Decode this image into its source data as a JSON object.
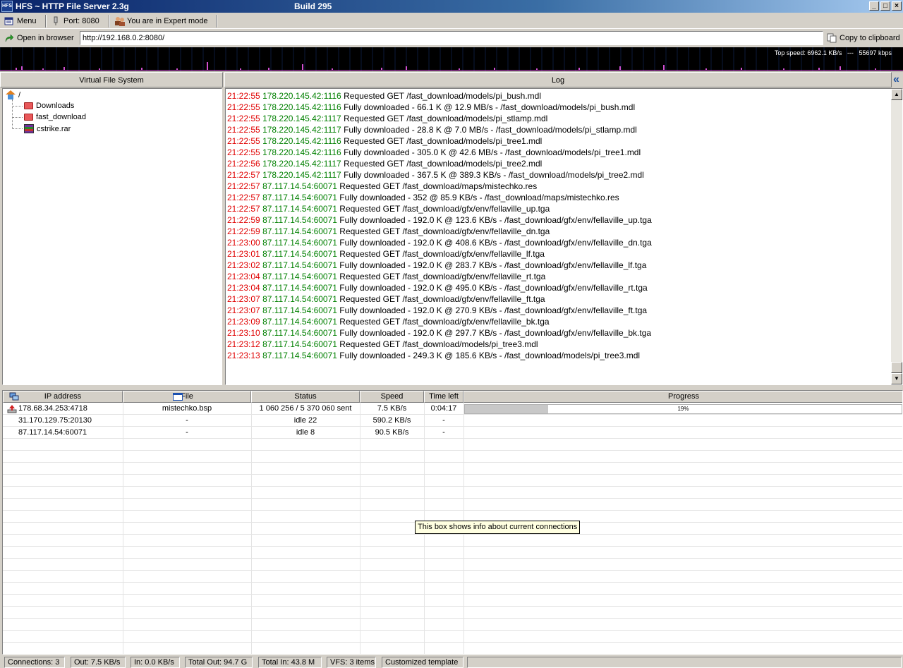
{
  "window": {
    "title": "HFS ~ HTTP File Server 2.3g",
    "build": "Build 295",
    "icon_label": "HFS",
    "buttons": [
      "_",
      "□",
      "×"
    ]
  },
  "toolbar": {
    "menu_label": "Menu",
    "port_label": "Port: 8080",
    "mode_label": "You are in Expert mode",
    "open_browser_label": "Open in browser",
    "url": "http://192.168.0.2:8080/",
    "copy_label": "Copy to clipboard"
  },
  "graph": {
    "top_speed": "Top speed: 6962.1 KB/s",
    "separator": "---",
    "current": "55697 kbps"
  },
  "vfs": {
    "header": "Virtual File System",
    "root": "/",
    "items": [
      {
        "label": "Downloads",
        "icon": "folder-icon"
      },
      {
        "label": "fast_download",
        "icon": "folder-icon"
      },
      {
        "label": "cstrike.rar",
        "icon": "rar-archive-icon"
      }
    ]
  },
  "log": {
    "header": "Log",
    "collapse_glyph": "«",
    "lines": [
      {
        "time": "21:22:55",
        "ip": "178.220.145.42:1116",
        "msg": "Requested GET /fast_download/models/pi_bush.mdl"
      },
      {
        "time": "21:22:55",
        "ip": "178.220.145.42:1116",
        "msg": "Fully downloaded - 66.1 K @ 12.9 MB/s - /fast_download/models/pi_bush.mdl"
      },
      {
        "time": "21:22:55",
        "ip": "178.220.145.42:1117",
        "msg": "Requested GET /fast_download/models/pi_stlamp.mdl"
      },
      {
        "time": "21:22:55",
        "ip": "178.220.145.42:1117",
        "msg": "Fully downloaded - 28.8 K @ 7.0 MB/s - /fast_download/models/pi_stlamp.mdl"
      },
      {
        "time": "21:22:55",
        "ip": "178.220.145.42:1116",
        "msg": "Requested GET /fast_download/models/pi_tree1.mdl"
      },
      {
        "time": "21:22:55",
        "ip": "178.220.145.42:1116",
        "msg": "Fully downloaded - 305.0 K @ 42.6 MB/s - /fast_download/models/pi_tree1.mdl"
      },
      {
        "time": "21:22:56",
        "ip": "178.220.145.42:1117",
        "msg": "Requested GET /fast_download/models/pi_tree2.mdl"
      },
      {
        "time": "21:22:57",
        "ip": "178.220.145.42:1117",
        "msg": "Fully downloaded - 367.5 K @ 389.3 KB/s - /fast_download/models/pi_tree2.mdl"
      },
      {
        "time": "21:22:57",
        "ip": "87.117.14.54:60071",
        "msg": "Requested GET /fast_download/maps/mistechko.res"
      },
      {
        "time": "21:22:57",
        "ip": "87.117.14.54:60071",
        "msg": "Fully downloaded - 352 @ 85.9 KB/s - /fast_download/maps/mistechko.res"
      },
      {
        "time": "21:22:57",
        "ip": "87.117.14.54:60071",
        "msg": "Requested GET /fast_download/gfx/env/fellaville_up.tga"
      },
      {
        "time": "21:22:59",
        "ip": "87.117.14.54:60071",
        "msg": "Fully downloaded - 192.0 K @ 123.6 KB/s - /fast_download/gfx/env/fellaville_up.tga"
      },
      {
        "time": "21:22:59",
        "ip": "87.117.14.54:60071",
        "msg": "Requested GET /fast_download/gfx/env/fellaville_dn.tga"
      },
      {
        "time": "21:23:00",
        "ip": "87.117.14.54:60071",
        "msg": "Fully downloaded - 192.0 K @ 408.6 KB/s - /fast_download/gfx/env/fellaville_dn.tga"
      },
      {
        "time": "21:23:01",
        "ip": "87.117.14.54:60071",
        "msg": "Requested GET /fast_download/gfx/env/fellaville_lf.tga"
      },
      {
        "time": "21:23:02",
        "ip": "87.117.14.54:60071",
        "msg": "Fully downloaded - 192.0 K @ 283.7 KB/s - /fast_download/gfx/env/fellaville_lf.tga"
      },
      {
        "time": "21:23:04",
        "ip": "87.117.14.54:60071",
        "msg": "Requested GET /fast_download/gfx/env/fellaville_rt.tga"
      },
      {
        "time": "21:23:04",
        "ip": "87.117.14.54:60071",
        "msg": "Fully downloaded - 192.0 K @ 495.0 KB/s - /fast_download/gfx/env/fellaville_rt.tga"
      },
      {
        "time": "21:23:07",
        "ip": "87.117.14.54:60071",
        "msg": "Requested GET /fast_download/gfx/env/fellaville_ft.tga"
      },
      {
        "time": "21:23:07",
        "ip": "87.117.14.54:60071",
        "msg": "Fully downloaded - 192.0 K @ 270.9 KB/s - /fast_download/gfx/env/fellaville_ft.tga"
      },
      {
        "time": "21:23:09",
        "ip": "87.117.14.54:60071",
        "msg": "Requested GET /fast_download/gfx/env/fellaville_bk.tga"
      },
      {
        "time": "21:23:10",
        "ip": "87.117.14.54:60071",
        "msg": "Fully downloaded - 192.0 K @ 297.7 KB/s - /fast_download/gfx/env/fellaville_bk.tga"
      },
      {
        "time": "21:23:12",
        "ip": "87.117.14.54:60071",
        "msg": "Requested GET /fast_download/models/pi_tree3.mdl"
      },
      {
        "time": "21:23:13",
        "ip": "87.117.14.54:60071",
        "msg": "Fully downloaded - 249.3 K @ 185.6 KB/s - /fast_download/models/pi_tree3.mdl"
      }
    ]
  },
  "connections": {
    "columns": [
      "IP address",
      "File",
      "Status",
      "Speed",
      "Time left",
      "Progress"
    ],
    "rows": [
      {
        "ip": "178.68.34.253:4718",
        "file": "mistechko.bsp",
        "status": "1 060 256 / 5 370 060 sent",
        "speed": "7.5 KB/s",
        "time_left": "0:04:17",
        "progress": 0.19,
        "progress_label": "19%",
        "uploading": true
      },
      {
        "ip": "31.170.129.75:20130",
        "file": "-",
        "status": "idle 22",
        "speed": "590.2 KB/s",
        "time_left": "-"
      },
      {
        "ip": "87.117.14.54:60071",
        "file": "-",
        "status": "idle 8",
        "speed": "90.5 KB/s",
        "time_left": "-"
      }
    ],
    "tooltip": "This box shows info about current connections"
  },
  "statusbar": {
    "items": [
      "Connections: 3",
      "Out: 7.5 KB/s",
      "In: 0.0 KB/s",
      "Total Out: 94.7 G",
      "Total In: 43.8 M",
      "VFS: 3 items",
      "Customized template"
    ]
  },
  "colors": {
    "log_time": "#e00000",
    "log_ip": "#008000",
    "graph_bg": "#000000",
    "graph_line": "#d04fd0"
  }
}
